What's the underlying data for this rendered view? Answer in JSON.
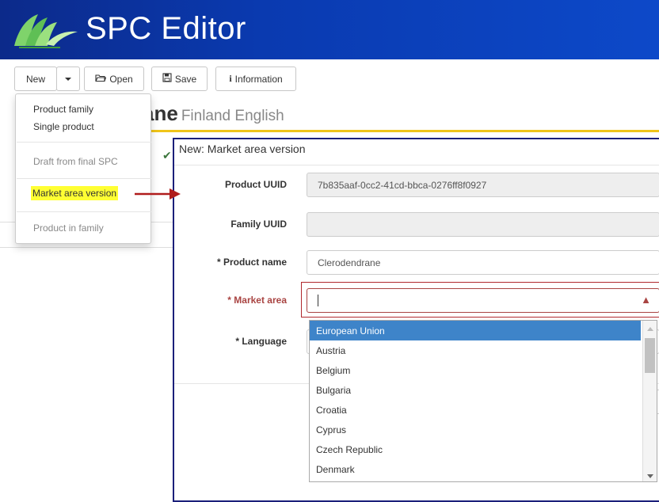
{
  "app": {
    "title": "SPC Editor"
  },
  "toolbar": {
    "new_label": "New",
    "open_label": "Open",
    "save_label": "Save",
    "information_label": "Information"
  },
  "page": {
    "heading_partial": "ane",
    "heading_sub": "Finland English"
  },
  "new_menu": {
    "items": [
      {
        "label": "Product family"
      },
      {
        "label": "Single product"
      },
      {
        "label": "Draft from final SPC"
      },
      {
        "label": "Market area version"
      },
      {
        "label": "Product in family"
      }
    ]
  },
  "dialog": {
    "title": "New: Market area version",
    "fields": {
      "product_uuid": {
        "label": "Product UUID",
        "value": "7b835aaf-0cc2-41cd-bbca-0276ff8f0927"
      },
      "family_uuid": {
        "label": "Family UUID",
        "value": ""
      },
      "product_name": {
        "label": "* Product name",
        "value": "Clerodendrane"
      },
      "market_area": {
        "label": "* Market area",
        "value": ""
      },
      "language": {
        "label": "* Language"
      }
    }
  },
  "market_area_options": [
    "European Union",
    "Austria",
    "Belgium",
    "Bulgaria",
    "Croatia",
    "Cyprus",
    "Czech Republic",
    "Denmark"
  ],
  "colors": {
    "header": "#0d3fb5",
    "highlight": "#ffff33",
    "selected_option": "#3e84c9",
    "error": "#a94442",
    "accent_rule": "#f0c419"
  },
  "icons": {
    "open": "folder-open-icon",
    "save": "floppy-disk-icon",
    "information": "info-icon",
    "warning": "warning-icon"
  }
}
